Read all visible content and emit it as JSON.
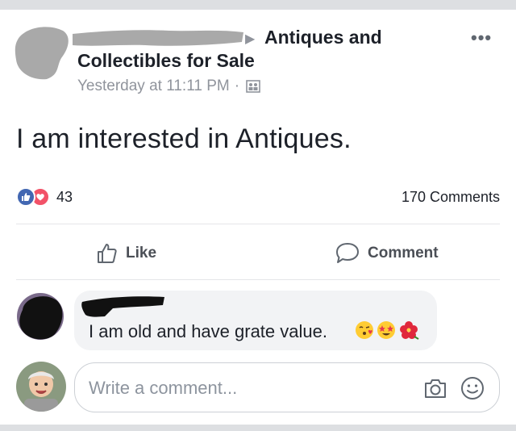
{
  "post": {
    "group_name_line1": "Antiques and",
    "group_name_line2": "Collectibles for Sale",
    "timestamp": "Yesterday at 11:11 PM",
    "meta_separator": "·",
    "more_options": "•••",
    "text": "I am interested in Antiques.",
    "reaction_count": "43",
    "comments_count": "170 Comments",
    "reaction_icons": [
      "like-icon",
      "love-icon"
    ]
  },
  "actions": {
    "like_label": "Like",
    "comment_label": "Comment"
  },
  "comment": {
    "text": "I am old and have grate value.",
    "emojis": [
      "kissing-face-icon",
      "star-struck-icon",
      "hibiscus-icon"
    ]
  },
  "composer": {
    "placeholder": "Write a comment..."
  },
  "colors": {
    "brand_blue": "#4267b2",
    "love_red": "#f25268",
    "text": "#1d2129",
    "secondary_text": "#90949c"
  }
}
